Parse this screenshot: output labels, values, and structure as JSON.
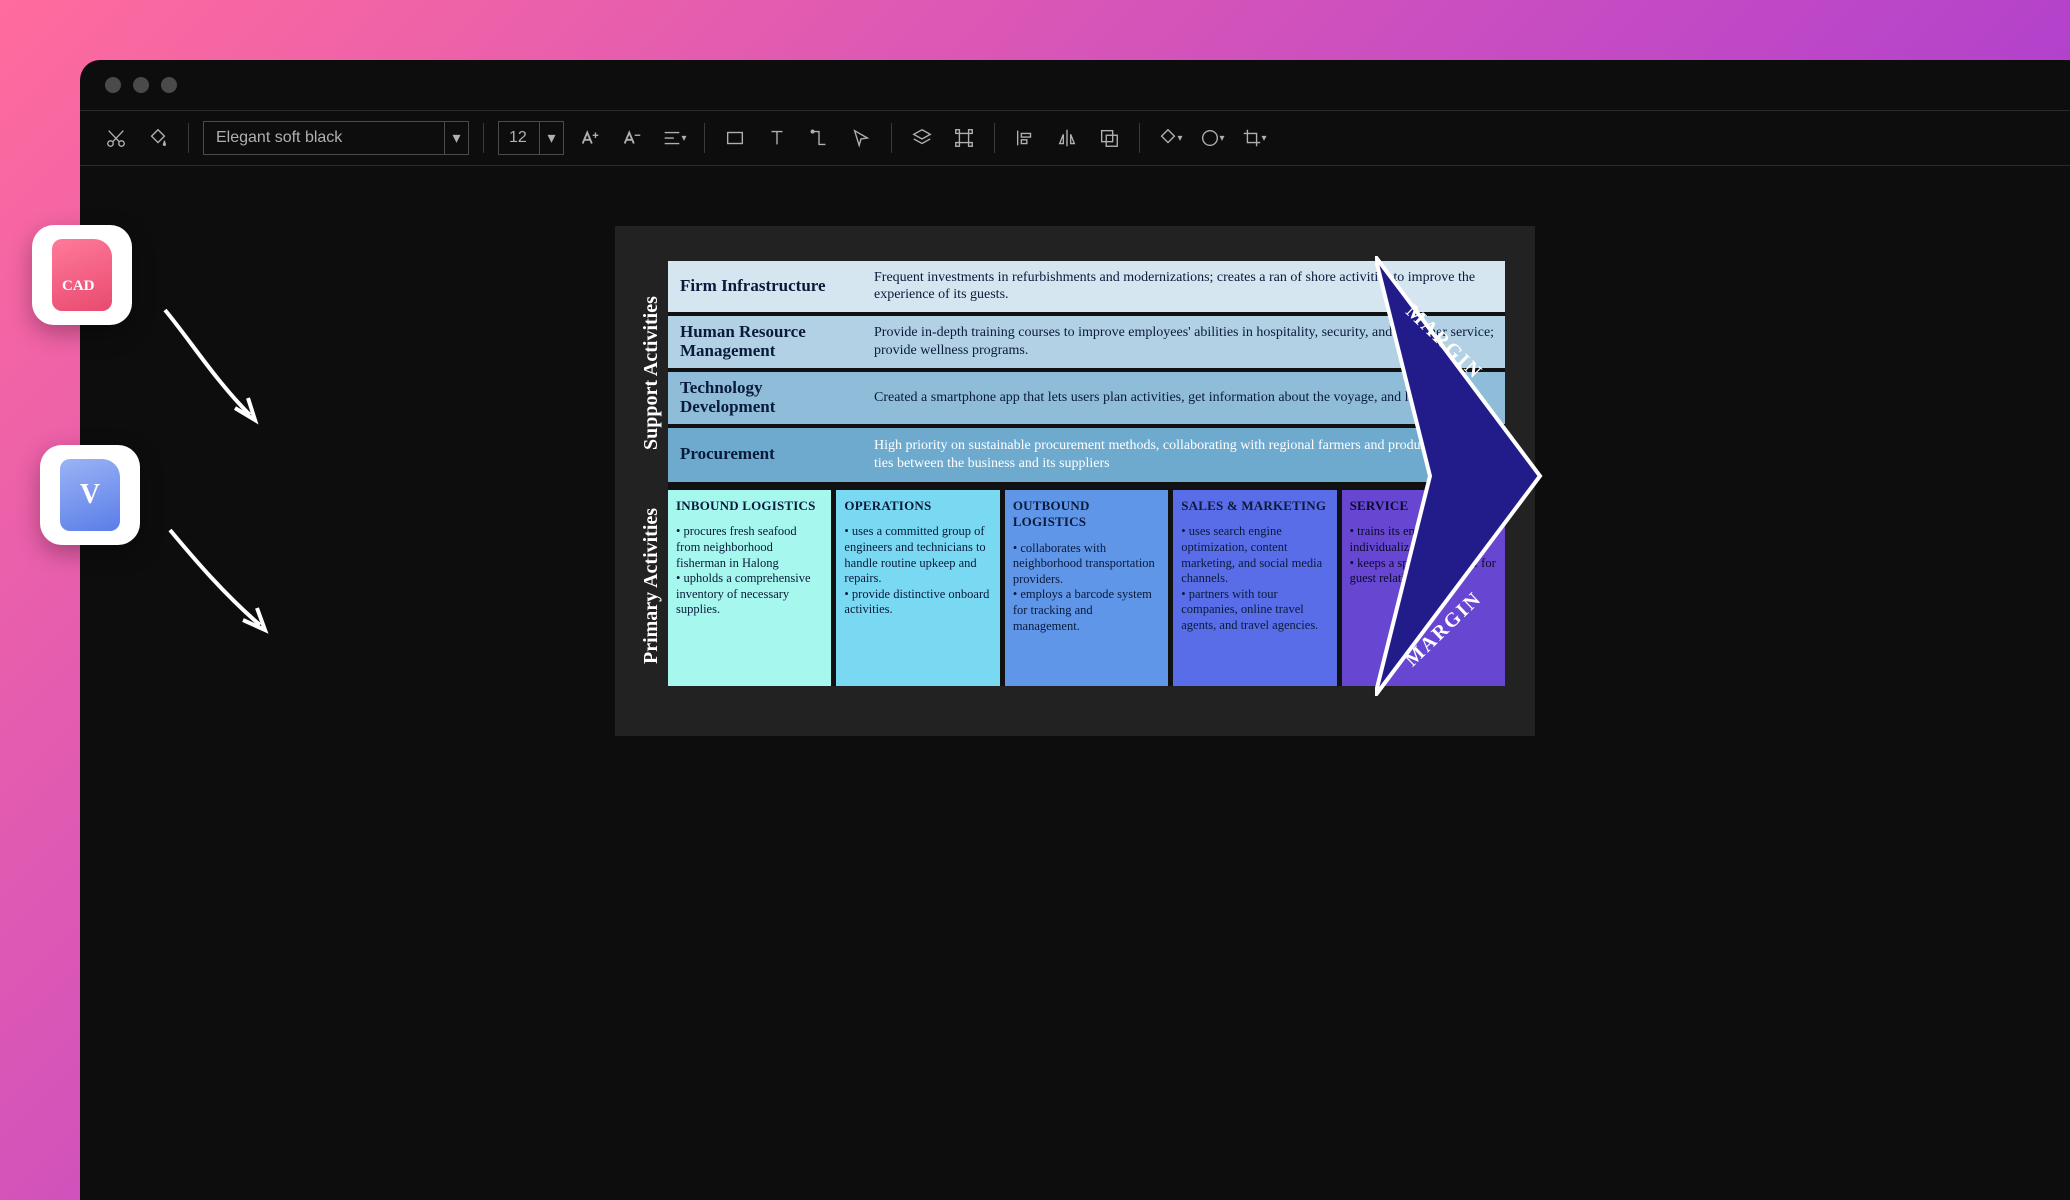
{
  "toolbar": {
    "font": "Elegant soft black",
    "fontSize": "12"
  },
  "diagram": {
    "support_label": "Support\nActivities",
    "primary_label": "Primary\nActivities",
    "margin": "MARGIN",
    "support_rows": [
      {
        "label": "Firm Infrastructure",
        "body": "Frequent investments in refurbishments and modernizations; creates a ran of shore activities to improve the experience of its guests."
      },
      {
        "label": "Human Resource Management",
        "body": "Provide in-depth training courses to improve employees' abilities in hospitality, security, and customer service; provide wellness programs."
      },
      {
        "label": "Technology Development",
        "body": "Created a smartphone app that lets users plan activities, get information about the voyage, and leave reviews."
      },
      {
        "label": "Procurement",
        "body": "High priority on sustainable procurement methods, collaborating with regional farmers and producers; Strong ties between the business and its suppliers"
      }
    ],
    "primary_cols": [
      {
        "title": "INBOUND LOGISTICS",
        "items": [
          "procures fresh seafood from neighborhood fisherman in Halong",
          "upholds a comprehensive inventory of necessary supplies."
        ]
      },
      {
        "title": "OPERATIONS",
        "items": [
          "uses a committed group of engineers and technicians to handle routine upkeep and repairs.",
          "provide distinctive onboard activities."
        ]
      },
      {
        "title": "OUTBOUND LOGISTICS",
        "items": [
          "collaborates with neighborhood transportation providers.",
          "employs a barcode system for tracking and management."
        ]
      },
      {
        "title": "SALES & MARKETING",
        "items": [
          "uses search engine optimization, content marketing, and social media channels.",
          "partners with tour companies, online travel agents, and travel agencies."
        ]
      },
      {
        "title": "SERVICE",
        "items": [
          "trains its employees to offer individualized service.",
          "keeps a specialized staff for guest relations."
        ]
      }
    ]
  },
  "floating": {
    "cad_label": "CAD",
    "visio_label": "V"
  }
}
